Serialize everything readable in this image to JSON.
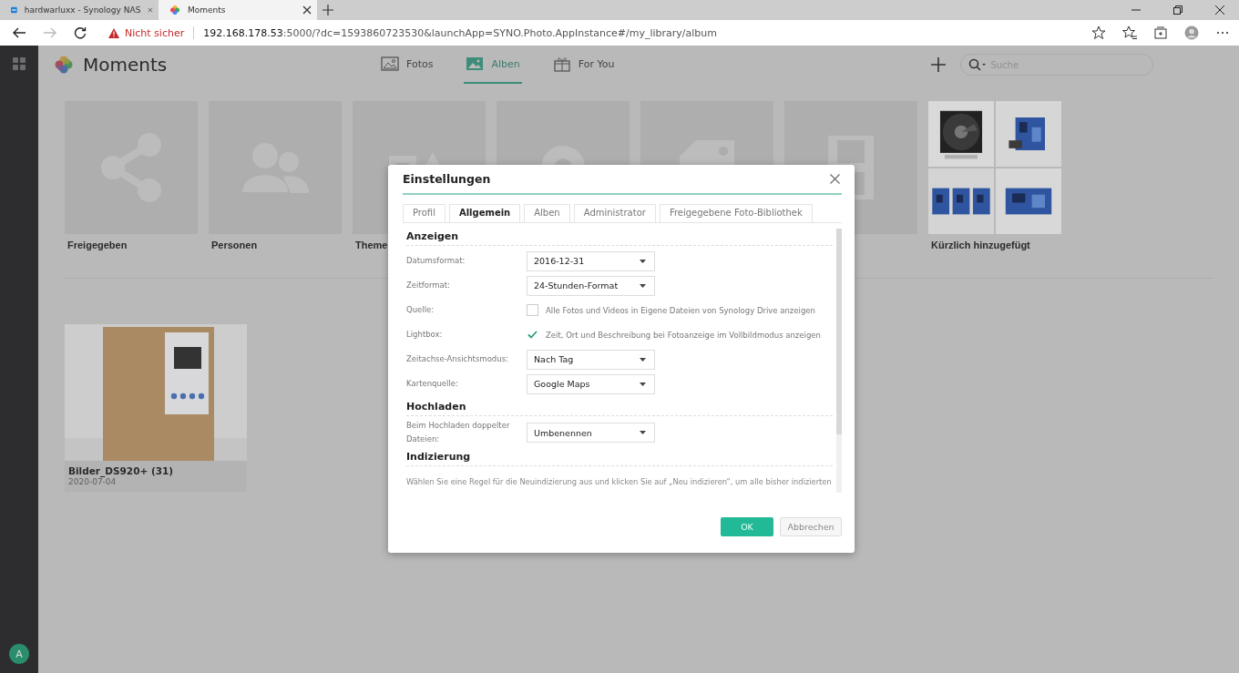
{
  "browser": {
    "tabs": [
      {
        "title": "hardwarluxx - Synology NAS",
        "selected": false
      },
      {
        "title": "Moments",
        "selected": true
      }
    ],
    "security": "Nicht sicher",
    "url_host": "192.168.178.53",
    "url_rest": ":5000/?dc=1593860723530&launchApp=SYNO.Photo.AppInstance#/my_library/album"
  },
  "sidebar": {
    "avatar": "A"
  },
  "app": {
    "title": "Moments",
    "nav": [
      {
        "label": "Fotos",
        "selected": false
      },
      {
        "label": "Alben",
        "selected": true
      },
      {
        "label": "For You",
        "selected": false
      }
    ],
    "search": {
      "placeholder": "Suche"
    }
  },
  "categories": [
    {
      "kind": "icon",
      "label": "Freigegeben"
    },
    {
      "kind": "icon",
      "label": "Personen"
    },
    {
      "kind": "icon",
      "label": "Theme"
    },
    {
      "kind": "icon"
    },
    {
      "kind": "icon"
    },
    {
      "kind": "icon"
    },
    {
      "kind": "photos",
      "label": "Kürzlich hinzugefügt"
    }
  ],
  "albums": [
    {
      "title": "Bilder_DS920+ (31)",
      "date": "2020-07-04"
    }
  ],
  "dialog": {
    "title": "Einstellungen",
    "tabs": [
      {
        "label": "Profil",
        "selected": false
      },
      {
        "label": "Allgemein",
        "selected": true
      },
      {
        "label": "Alben",
        "selected": false
      },
      {
        "label": "Administrator",
        "selected": false
      },
      {
        "label": "Freigegebene Foto-Bibliothek",
        "selected": false
      }
    ],
    "sections": [
      {
        "heading": "Anzeigen",
        "rows": [
          {
            "kind": "select",
            "label": "Datumsformat:",
            "value": "2016-12-31"
          },
          {
            "kind": "select",
            "label": "Zeitformat:",
            "value": "24-Stunden-Format"
          },
          {
            "kind": "checkbox",
            "label": "Quelle:",
            "text": "Alle Fotos und Videos in Eigene Dateien von Synology Drive anzeigen",
            "checked": false
          },
          {
            "kind": "checkbox",
            "label": "Lightbox:",
            "text": "Zeit, Ort und Beschreibung bei Fotoanzeige im Vollbildmodus anzeigen",
            "checked": true
          },
          {
            "kind": "select",
            "label": "Zeitachse-Ansichtsmodus:",
            "value": "Nach Tag"
          },
          {
            "kind": "select",
            "label": "Kartenquelle:",
            "value": "Google Maps"
          }
        ]
      },
      {
        "heading": "Hochladen",
        "rows": [
          {
            "kind": "select",
            "label": "Beim Hochladen doppelter Dateien:",
            "value": "Umbenennen"
          }
        ]
      },
      {
        "heading": "Indizierung",
        "rows": [
          {
            "kind": "text",
            "text": "Wählen Sie eine Regel für die Neuindizierung aus und klicken Sie auf „Neu indizieren“, um alle bisher indizierten"
          }
        ]
      }
    ],
    "buttons": [
      {
        "label": "OK",
        "kind": "primary"
      },
      {
        "label": "Abbrechen",
        "kind": "secondary"
      }
    ]
  }
}
